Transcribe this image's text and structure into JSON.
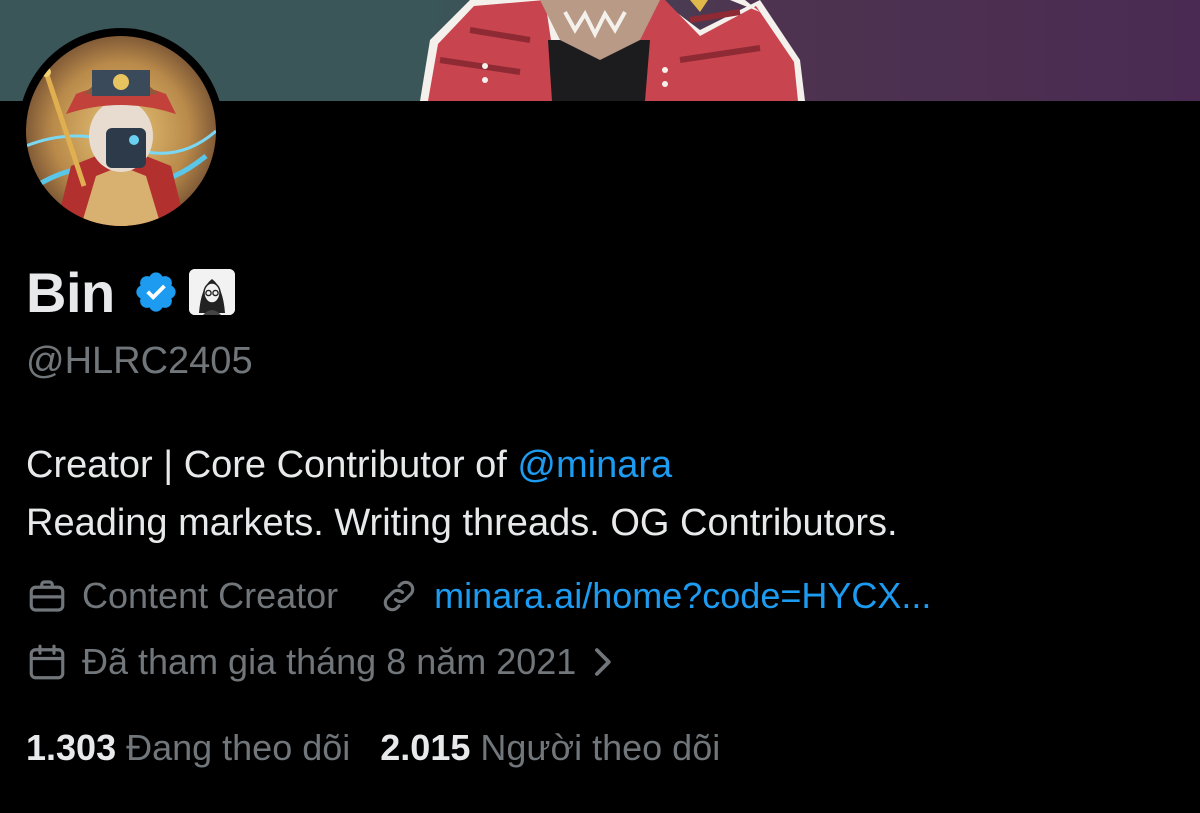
{
  "profile": {
    "display_name": "Bin",
    "handle": "@HLRC2405",
    "verified_icon": "verified-badge-icon",
    "affiliate_icon": "affiliate-avatar-badge"
  },
  "bio": {
    "line1_prefix": "Creator | Core Contributor of ",
    "line1_mention": "@minara",
    "line2": "Reading markets. Writing threads. OG Contributors."
  },
  "meta": {
    "category_icon": "briefcase-icon",
    "category": "Content Creator",
    "link_icon": "link-icon",
    "link_text": "minara.ai/home?code=HYCX...",
    "joined_icon": "calendar-icon",
    "joined_text": "Đã tham gia tháng 8 năm 2021",
    "joined_chevron": "chevron-right-icon"
  },
  "stats": {
    "following_count": "1.303",
    "following_label": "Đang theo dõi",
    "followers_count": "2.015",
    "followers_label": "Người theo dõi"
  },
  "colors": {
    "background": "#000000",
    "primary_text": "#e7e9ea",
    "secondary_text": "#71767b",
    "accent_link": "#1d9bf0",
    "banner_left": "#3a5658",
    "banner_right": "#4a2a52"
  }
}
